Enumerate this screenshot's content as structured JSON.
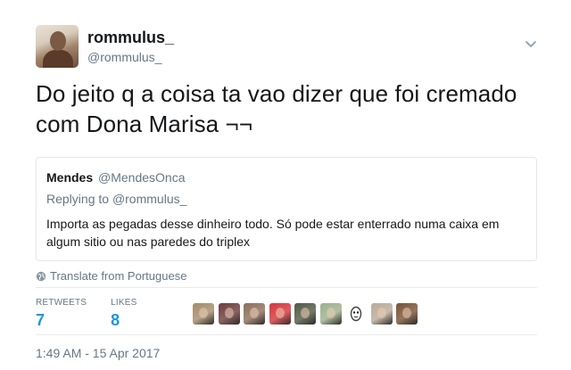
{
  "author": {
    "display_name": "rommulus_",
    "handle": "@rommulus_"
  },
  "tweet": {
    "text_line1": "Do jeito q a coisa ta vao dizer que foi cremado",
    "text_line2": "com Dona Marisa ¬¬"
  },
  "quoted": {
    "name": "Mendes",
    "handle": "@MendesOnca",
    "replying_prefix": "Replying to",
    "replying_to": "@rommulus_",
    "text_line1": "Importa as pegadas desse dinheiro todo. Só pode estar enterrado numa caixa em",
    "text_line2": "algum sitio ou nas paredes do triplex"
  },
  "translate_label": "Translate from Portuguese",
  "stats": {
    "retweets_label": "RETWEETS",
    "retweets_value": "7",
    "likes_label": "LIKES",
    "likes_value": "8"
  },
  "likers": [
    {
      "icon": "liker-avatar-1",
      "color": "#a48b6a"
    },
    {
      "icon": "liker-avatar-2",
      "color": "#6d3b3b"
    },
    {
      "icon": "liker-avatar-3",
      "color": "#8d6e5a"
    },
    {
      "icon": "liker-avatar-4",
      "color": "#d4353a"
    },
    {
      "icon": "liker-avatar-5",
      "color": "#4f5a44"
    },
    {
      "icon": "liker-avatar-6",
      "color": "#9db08c"
    },
    {
      "icon": "liker-avatar-7",
      "color": "#ffffff"
    },
    {
      "icon": "liker-avatar-8",
      "color": "#b9aa98"
    },
    {
      "icon": "liker-avatar-9",
      "color": "#7a5235"
    }
  ],
  "timestamp": "1:49 AM - 15 Apr 2017",
  "colors": {
    "link_blue": "#1b95e0",
    "secondary_gray": "#657786",
    "border": "#e1e8ed"
  }
}
